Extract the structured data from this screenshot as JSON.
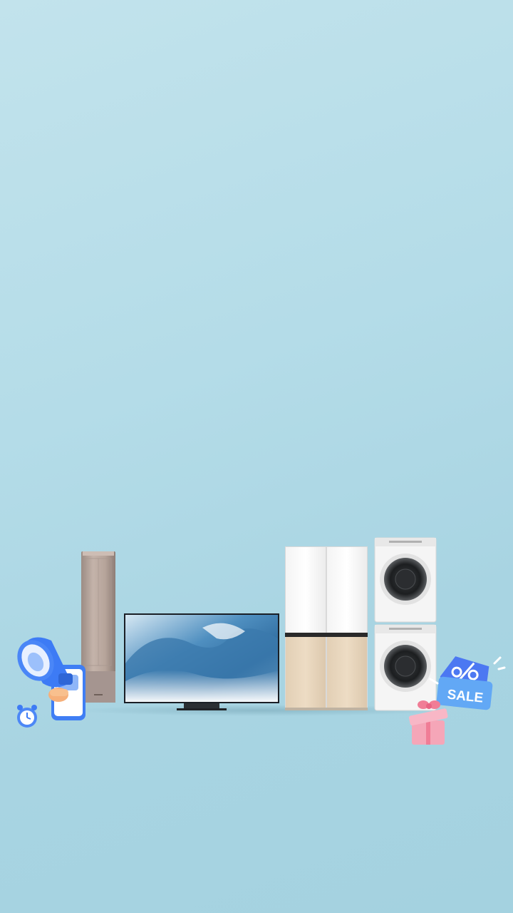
{
  "banner": {
    "sale_badge": {
      "label": "SALE",
      "icon": "percent-tag-icon"
    },
    "products": [
      {
        "name": "air-conditioner",
        "icon": "floor-air-conditioner"
      },
      {
        "name": "television",
        "icon": "flat-screen-tv"
      },
      {
        "name": "refrigerator",
        "icon": "four-door-refrigerator"
      },
      {
        "name": "washer-dryer",
        "icon": "stacked-washer-dryer"
      }
    ],
    "decorations": [
      "megaphone-icon",
      "alarm-clock-icon",
      "smartphone-icon",
      "gift-box-icon"
    ]
  },
  "colors": {
    "background": "#b4dce8",
    "sale_blue": "#3a7cf0",
    "megaphone_blue": "#3d7bf5",
    "gift_pink": "#f5a6b8",
    "fridge_beige": "#e8d6bc",
    "aircon_taupe": "#b7a59c"
  }
}
